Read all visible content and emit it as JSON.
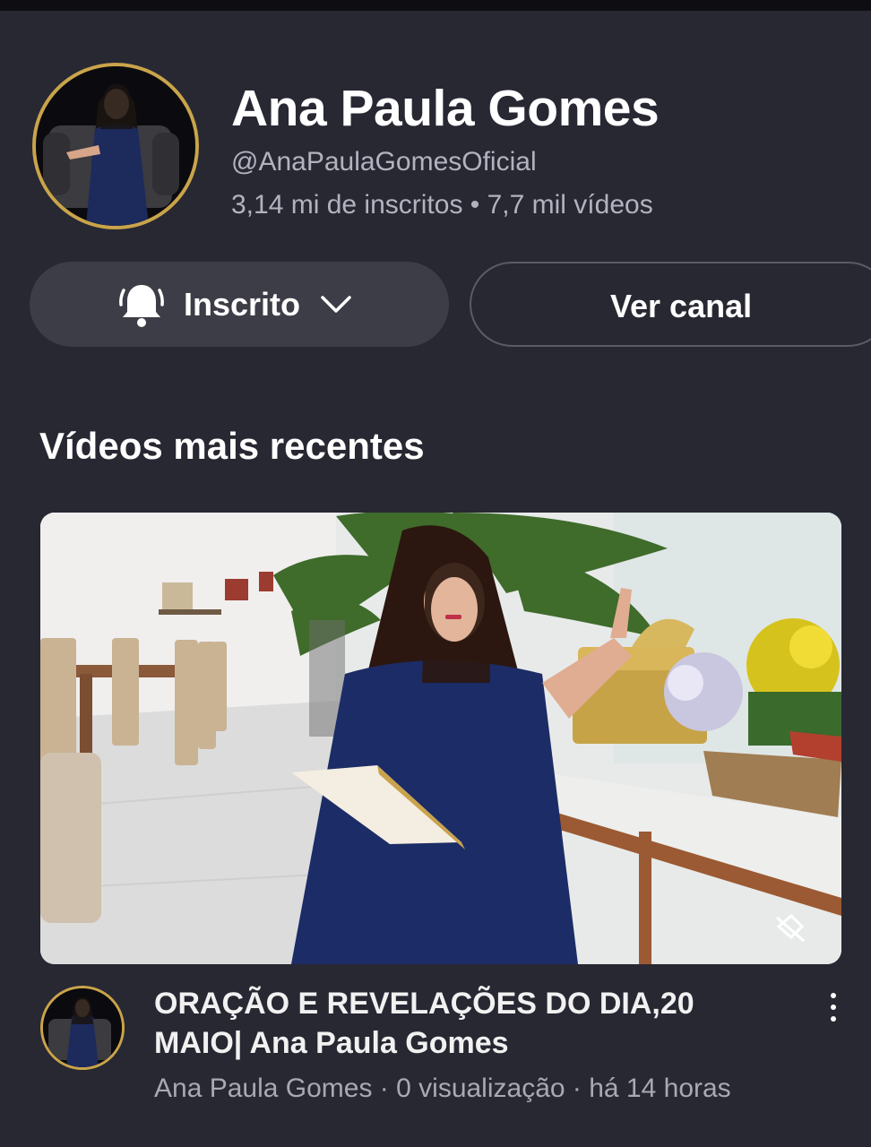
{
  "channel": {
    "name": "Ana Paula Gomes",
    "handle": "@AnaPaulaGomesOficial",
    "stats": "3,14 mi de inscritos • 7,7 mil vídeos"
  },
  "buttons": {
    "subscribed_label": "Inscrito",
    "view_channel_label": "Ver canal"
  },
  "section": {
    "title": "Vídeos mais recentes"
  },
  "video": {
    "title": "ORAÇÃO E REVELAÇÕES DO DIA,20 MAIO| Ana Paula Gomes",
    "meta": "Ana Paula Gomes · 0 visualização · há 14 horas"
  },
  "icons": [
    "bell-icon",
    "chevron-down-icon",
    "more-vert-icon",
    "mute-icon"
  ],
  "colors": {
    "background": "#282833",
    "avatar_ring": "#c9a44a",
    "button_fill": "#3d3d47"
  }
}
